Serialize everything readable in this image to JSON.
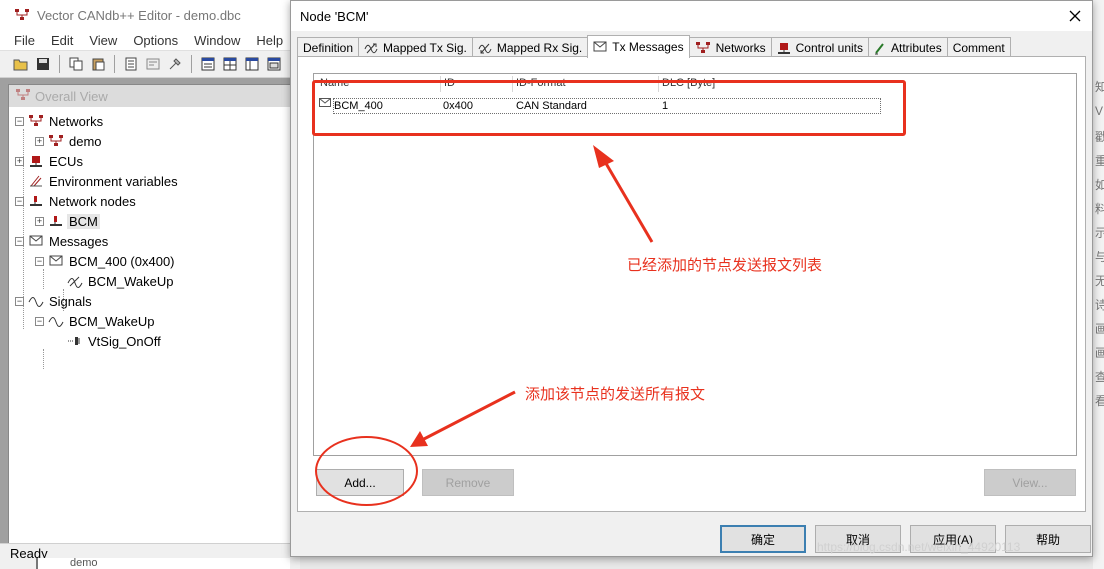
{
  "main_window": {
    "title": "Vector CANdb++ Editor - demo.dbc",
    "menu": [
      "File",
      "Edit",
      "View",
      "Options",
      "Window",
      "Help"
    ],
    "toolbar_icons": [
      "open-folder-icon",
      "save-icon",
      "copy-icon",
      "paste-icon",
      "new-db-icon",
      "properties-icon",
      "tools-icon",
      "view-list-icon",
      "view-grid-icon",
      "view-split-icon",
      "view-detail-icon"
    ],
    "overall_view_title": "Overall View",
    "tree": [
      {
        "label": "Networks",
        "icon": "network-icon"
      },
      {
        "label": "demo",
        "icon": "network-icon"
      },
      {
        "label": "ECUs",
        "icon": "ecu-icon"
      },
      {
        "label": "Environment variables",
        "icon": "env-var-icon"
      },
      {
        "label": "Network nodes",
        "icon": "node-icon"
      },
      {
        "label": "BCM",
        "icon": "node-icon"
      },
      {
        "label": "Messages",
        "icon": "message-icon"
      },
      {
        "label": "BCM_400 (0x400)",
        "icon": "message-icon"
      },
      {
        "label": "BCM_WakeUp",
        "icon": "signal-icon"
      },
      {
        "label": "Signals",
        "icon": "signal-icon"
      },
      {
        "label": "BCM_WakeUp",
        "icon": "signal-icon"
      },
      {
        "label": "VtSig_OnOff",
        "icon": "env-signal-icon"
      }
    ],
    "status": "Ready",
    "bottom_peek_label": "demo"
  },
  "right_peek_chars": [
    "知",
    "V",
    "戳",
    "重",
    "如",
    "料",
    "示",
    "与",
    "无",
    "诗",
    "画",
    "画",
    "查",
    "看"
  ],
  "dialog": {
    "title": "Node 'BCM'",
    "tabs": [
      {
        "label": "Definition",
        "icon": ""
      },
      {
        "label": "Mapped Tx Sig.",
        "icon": "mapped-tx-icon"
      },
      {
        "label": "Mapped Rx Sig.",
        "icon": "mapped-rx-icon"
      },
      {
        "label": "Tx Messages",
        "icon": "message-icon",
        "active": true
      },
      {
        "label": "Networks",
        "icon": "network-icon"
      },
      {
        "label": "Control units",
        "icon": "ecu-icon"
      },
      {
        "label": "Attributes",
        "icon": "attributes-icon"
      },
      {
        "label": "Comment",
        "icon": ""
      }
    ],
    "table": {
      "columns": [
        "Name",
        "ID",
        "ID-Format",
        "DLC [Byte]"
      ],
      "rows": [
        {
          "name": "BCM_400",
          "id": "0x400",
          "id_format": "CAN Standard",
          "dlc": "1"
        }
      ]
    },
    "buttons": {
      "add": "Add...",
      "remove": "Remove",
      "view": "View...",
      "ok": "确定",
      "cancel": "取消",
      "apply": "应用(A)",
      "help": "帮助"
    }
  },
  "annotations": {
    "list_note": "已经添加的节点发送报文列表",
    "add_note": "添加该节点的发送所有报文",
    "color": "#e8311e"
  },
  "watermark": "https://blog.csdn.net/weixin_44920113"
}
